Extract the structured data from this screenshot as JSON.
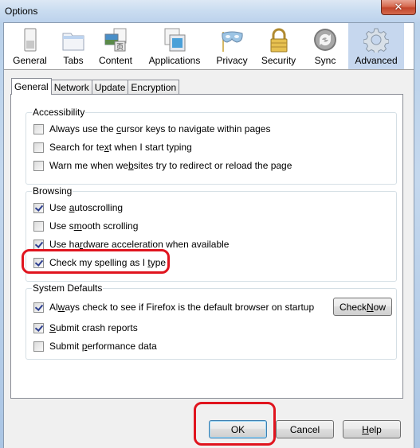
{
  "window": {
    "title": "Options",
    "close_symbol": "✕"
  },
  "toolbar": {
    "panes": [
      {
        "label": "General",
        "icon": "general-switch-icon",
        "selected": false
      },
      {
        "label": "Tabs",
        "icon": "tabs-folder-icon",
        "selected": false
      },
      {
        "label": "Content",
        "icon": "content-page-icon",
        "selected": false
      },
      {
        "label": "Applications",
        "icon": "applications-window-icon",
        "selected": false
      },
      {
        "label": "Privacy",
        "icon": "privacy-mask-icon",
        "selected": false
      },
      {
        "label": "Security",
        "icon": "security-padlock-icon",
        "selected": false
      },
      {
        "label": "Sync",
        "icon": "sync-arrows-icon",
        "selected": false
      },
      {
        "label": "Advanced",
        "icon": "advanced-gear-icon",
        "selected": true
      }
    ]
  },
  "tabs": [
    {
      "label": "General",
      "active": true
    },
    {
      "label": "Network",
      "active": false
    },
    {
      "label": "Update",
      "active": false
    },
    {
      "label": "Encryption",
      "active": false
    }
  ],
  "groups": {
    "accessibility": {
      "title": "Accessibility",
      "items": [
        {
          "pre": "Always use the ",
          "key": "c",
          "post": "ursor keys to navigate within pages",
          "checked": false
        },
        {
          "pre": "Search for te",
          "key": "x",
          "post": "t when I start typing",
          "checked": false
        },
        {
          "pre": "Warn me when we",
          "key": "b",
          "post": "sites try to redirect or reload the page",
          "checked": false
        }
      ]
    },
    "browsing": {
      "title": "Browsing",
      "items": [
        {
          "pre": "Use ",
          "key": "a",
          "post": "utoscrolling",
          "checked": true
        },
        {
          "pre": "Use s",
          "key": "m",
          "post": "ooth scrolling",
          "checked": false
        },
        {
          "pre": "Use ha",
          "key": "r",
          "post": "dware acceleration when available",
          "checked": true
        },
        {
          "pre": "Check my spelling as I ",
          "key": "t",
          "post": "ype",
          "checked": true
        }
      ]
    },
    "system_defaults": {
      "title": "System Defaults",
      "items": [
        {
          "pre": "Al",
          "key": "w",
          "post": "ays check to see if Firefox is the default browser on startup",
          "checked": true
        },
        {
          "pre": "",
          "key": "S",
          "post": "ubmit crash reports",
          "checked": true
        },
        {
          "pre": "Submit ",
          "key": "p",
          "post": "erformance data",
          "checked": false
        }
      ],
      "check_now": {
        "pre": "Check ",
        "key": "N",
        "post": "ow"
      }
    }
  },
  "buttons": {
    "ok": "OK",
    "cancel": "Cancel",
    "help": {
      "pre": "",
      "key": "H",
      "post": "elp"
    }
  },
  "annotations": {
    "color": "#e0141e"
  }
}
